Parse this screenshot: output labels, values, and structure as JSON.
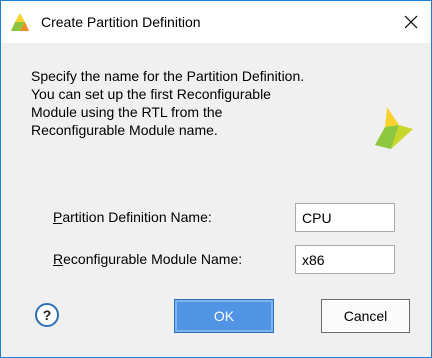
{
  "window": {
    "title": "Create Partition Definition",
    "close_symbol": "✕"
  },
  "description": {
    "lines": [
      "Specify the name for the Partition Definition.",
      "You can set up the first Reconfigurable",
      "Module using the RTL from the",
      "Reconfigurable Module name."
    ]
  },
  "form": {
    "partition_label_mnemonic": "P",
    "partition_label_rest": "artition Definition Name:",
    "partition_value": "CPU",
    "module_label_mnemonic": "R",
    "module_label_rest": "econfigurable Module Name:",
    "module_value": "x86"
  },
  "buttons": {
    "help_label": "?",
    "ok_label": "OK",
    "cancel_label": "Cancel"
  },
  "icons": {
    "app": "xilinx-logo-icon",
    "brand": "xilinx-logo-icon",
    "close": "close-icon",
    "help": "help-icon"
  },
  "colors": {
    "accent_border": "#1f7ed1",
    "ok_button": "#4f95e4",
    "logo_green": "#8dc63f",
    "logo_yellow": "#f9d12c",
    "logo_orange": "#f08a21"
  }
}
